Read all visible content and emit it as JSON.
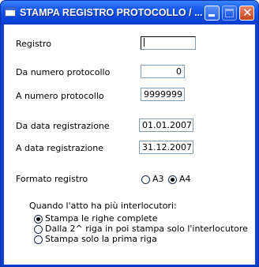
{
  "window": {
    "title": "STAMPA REGISTRO PROTOCOLLO / ...",
    "icons": {
      "app": "form-icon",
      "minimize": "minimize-icon",
      "maximize": "maximize-icon",
      "close": "close-icon"
    }
  },
  "form": {
    "registro": {
      "label": "Registro",
      "value": ""
    },
    "da_numero": {
      "label": "Da numero protocollo",
      "value": "0"
    },
    "a_numero": {
      "label": "A  numero protocollo",
      "value": "9999999"
    },
    "da_data": {
      "label": "Da data registrazione",
      "value": "01.01.2007"
    },
    "a_data": {
      "label": "A  data registrazione",
      "value": "31.12.2007"
    },
    "formato": {
      "label": "Formato registro",
      "options": [
        {
          "label": "A3",
          "selected": false
        },
        {
          "label": "A4",
          "selected": true
        }
      ]
    },
    "interlocutori": {
      "label": "Quando l'atto ha più interlocutori:",
      "options": [
        {
          "label": "Stampa le righe complete",
          "selected": true
        },
        {
          "label": "Dalla 2^ riga in poi stampa solo l'interlocutore",
          "selected": false
        },
        {
          "label": "Stampa solo la prima riga",
          "selected": false
        }
      ]
    }
  }
}
